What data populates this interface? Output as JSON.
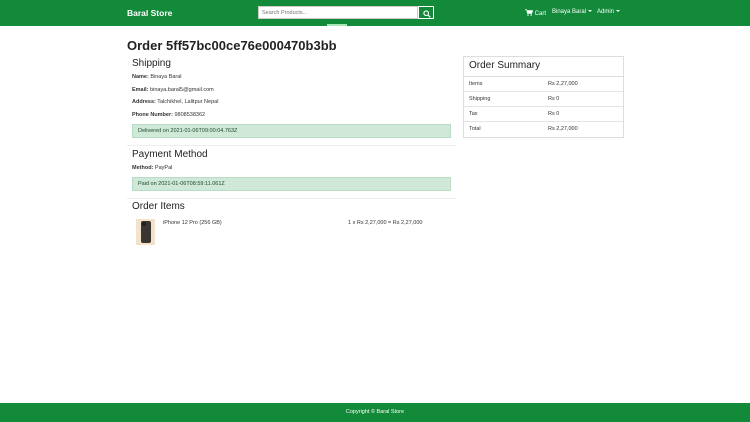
{
  "navbar": {
    "brand": "Baral Store",
    "search": {
      "placeholder": "Search Products..."
    },
    "cart_label": "Cart",
    "user_label": "Binaya Baral",
    "admin_label": "Admin"
  },
  "order": {
    "title": "Order 5ff57bc00ce76e000470b3bb"
  },
  "shipping": {
    "heading": "Shipping",
    "name_label": "Name:",
    "name": "Binaya Baral",
    "email_label": "Email:",
    "email": "binaya.baral5@gmail.com",
    "address_label": "Address:",
    "address": "Talchikhel, Lalitpur Nepal",
    "phone_label": "Phone Number:",
    "phone": "9808538362",
    "status": "Delivered on 2021-01-06T09:00:04.763Z"
  },
  "payment": {
    "heading": "Payment Method",
    "method_label": "Method:",
    "method": "PayPal",
    "status": "Paid on 2021-01-06T08:59:11.061Z"
  },
  "order_items": {
    "heading": "Order Items",
    "items": [
      {
        "name": "iPhone 12 Pro (256 GB)",
        "price_line": "1 x Rs 2,27,000 = Rs 2,27,000"
      }
    ]
  },
  "summary": {
    "heading": "Order Summary",
    "rows": [
      {
        "label": "Items",
        "value": "Rs 2,27,000"
      },
      {
        "label": "Shipping",
        "value": "Rs 0"
      },
      {
        "label": "Tax",
        "value": "Rs 0"
      },
      {
        "label": "Total",
        "value": "Rs 2,27,000"
      }
    ]
  },
  "footer": {
    "text": "Copyright © Baral Store"
  },
  "colors": {
    "brand": "#128a3a",
    "alert_bg": "#cfe8d8"
  },
  "icons": {
    "search": "search-icon",
    "cart": "cart-icon"
  }
}
